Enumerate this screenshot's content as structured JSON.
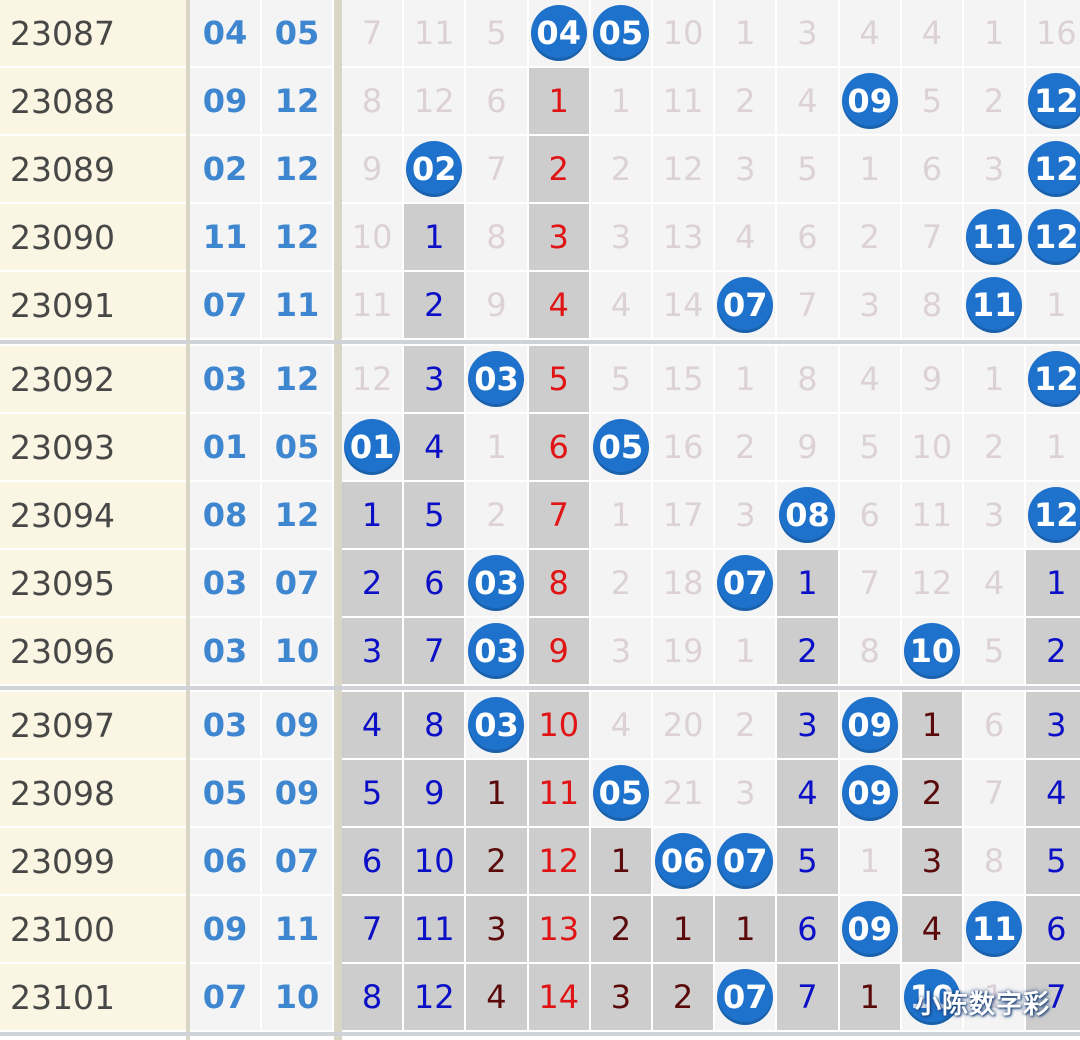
{
  "rows": [
    {
      "issue": "23087",
      "draw": [
        "04",
        "05"
      ],
      "cells": [
        {
          "t": "7",
          "s": "cold"
        },
        {
          "t": "11",
          "s": "cold"
        },
        {
          "t": "5",
          "s": "cold"
        },
        {
          "t": "04",
          "s": "ball"
        },
        {
          "t": "05",
          "s": "ball"
        },
        {
          "t": "10",
          "s": "cold"
        },
        {
          "t": "1",
          "s": "cold"
        },
        {
          "t": "3",
          "s": "cold"
        },
        {
          "t": "4",
          "s": "cold"
        },
        {
          "t": "4",
          "s": "cold"
        },
        {
          "t": "1",
          "s": "cold"
        },
        {
          "t": "16",
          "s": "cold"
        }
      ]
    },
    {
      "issue": "23088",
      "draw": [
        "09",
        "12"
      ],
      "cells": [
        {
          "t": "8",
          "s": "cold"
        },
        {
          "t": "12",
          "s": "cold"
        },
        {
          "t": "6",
          "s": "cold"
        },
        {
          "t": "1",
          "s": "red"
        },
        {
          "t": "1",
          "s": "cold"
        },
        {
          "t": "11",
          "s": "cold"
        },
        {
          "t": "2",
          "s": "cold"
        },
        {
          "t": "4",
          "s": "cold"
        },
        {
          "t": "09",
          "s": "ball"
        },
        {
          "t": "5",
          "s": "cold"
        },
        {
          "t": "2",
          "s": "cold"
        },
        {
          "t": "12",
          "s": "ball"
        }
      ]
    },
    {
      "issue": "23089",
      "draw": [
        "02",
        "12"
      ],
      "cells": [
        {
          "t": "9",
          "s": "cold"
        },
        {
          "t": "02",
          "s": "ball"
        },
        {
          "t": "7",
          "s": "cold"
        },
        {
          "t": "2",
          "s": "red"
        },
        {
          "t": "2",
          "s": "cold"
        },
        {
          "t": "12",
          "s": "cold"
        },
        {
          "t": "3",
          "s": "cold"
        },
        {
          "t": "5",
          "s": "cold"
        },
        {
          "t": "1",
          "s": "cold"
        },
        {
          "t": "6",
          "s": "cold"
        },
        {
          "t": "3",
          "s": "cold"
        },
        {
          "t": "12",
          "s": "ball"
        }
      ]
    },
    {
      "issue": "23090",
      "draw": [
        "11",
        "12"
      ],
      "cells": [
        {
          "t": "10",
          "s": "cold"
        },
        {
          "t": "1",
          "s": "blue"
        },
        {
          "t": "8",
          "s": "cold"
        },
        {
          "t": "3",
          "s": "red"
        },
        {
          "t": "3",
          "s": "cold"
        },
        {
          "t": "13",
          "s": "cold"
        },
        {
          "t": "4",
          "s": "cold"
        },
        {
          "t": "6",
          "s": "cold"
        },
        {
          "t": "2",
          "s": "cold"
        },
        {
          "t": "7",
          "s": "cold"
        },
        {
          "t": "11",
          "s": "ball"
        },
        {
          "t": "12",
          "s": "ball"
        }
      ]
    },
    {
      "issue": "23091",
      "draw": [
        "07",
        "11"
      ],
      "cells": [
        {
          "t": "11",
          "s": "cold"
        },
        {
          "t": "2",
          "s": "blue"
        },
        {
          "t": "9",
          "s": "cold"
        },
        {
          "t": "4",
          "s": "red"
        },
        {
          "t": "4",
          "s": "cold"
        },
        {
          "t": "14",
          "s": "cold"
        },
        {
          "t": "07",
          "s": "ball"
        },
        {
          "t": "7",
          "s": "cold"
        },
        {
          "t": "3",
          "s": "cold"
        },
        {
          "t": "8",
          "s": "cold"
        },
        {
          "t": "11",
          "s": "ball"
        },
        {
          "t": "1",
          "s": "cold"
        }
      ]
    },
    {
      "issue": "23092",
      "draw": [
        "03",
        "12"
      ],
      "cells": [
        {
          "t": "12",
          "s": "cold"
        },
        {
          "t": "3",
          "s": "blue"
        },
        {
          "t": "03",
          "s": "ball"
        },
        {
          "t": "5",
          "s": "red"
        },
        {
          "t": "5",
          "s": "cold"
        },
        {
          "t": "15",
          "s": "cold"
        },
        {
          "t": "1",
          "s": "cold"
        },
        {
          "t": "8",
          "s": "cold"
        },
        {
          "t": "4",
          "s": "cold"
        },
        {
          "t": "9",
          "s": "cold"
        },
        {
          "t": "1",
          "s": "cold"
        },
        {
          "t": "12",
          "s": "ball"
        }
      ]
    },
    {
      "issue": "23093",
      "draw": [
        "01",
        "05"
      ],
      "cells": [
        {
          "t": "01",
          "s": "ball"
        },
        {
          "t": "4",
          "s": "blue"
        },
        {
          "t": "1",
          "s": "cold"
        },
        {
          "t": "6",
          "s": "red"
        },
        {
          "t": "05",
          "s": "ball"
        },
        {
          "t": "16",
          "s": "cold"
        },
        {
          "t": "2",
          "s": "cold"
        },
        {
          "t": "9",
          "s": "cold"
        },
        {
          "t": "5",
          "s": "cold"
        },
        {
          "t": "10",
          "s": "cold"
        },
        {
          "t": "2",
          "s": "cold"
        },
        {
          "t": "1",
          "s": "cold"
        }
      ]
    },
    {
      "issue": "23094",
      "draw": [
        "08",
        "12"
      ],
      "cells": [
        {
          "t": "1",
          "s": "blue"
        },
        {
          "t": "5",
          "s": "blue"
        },
        {
          "t": "2",
          "s": "cold"
        },
        {
          "t": "7",
          "s": "red"
        },
        {
          "t": "1",
          "s": "cold"
        },
        {
          "t": "17",
          "s": "cold"
        },
        {
          "t": "3",
          "s": "cold"
        },
        {
          "t": "08",
          "s": "ball"
        },
        {
          "t": "6",
          "s": "cold"
        },
        {
          "t": "11",
          "s": "cold"
        },
        {
          "t": "3",
          "s": "cold"
        },
        {
          "t": "12",
          "s": "ball"
        }
      ]
    },
    {
      "issue": "23095",
      "draw": [
        "03",
        "07"
      ],
      "cells": [
        {
          "t": "2",
          "s": "blue"
        },
        {
          "t": "6",
          "s": "blue"
        },
        {
          "t": "03",
          "s": "ball"
        },
        {
          "t": "8",
          "s": "red"
        },
        {
          "t": "2",
          "s": "cold"
        },
        {
          "t": "18",
          "s": "cold"
        },
        {
          "t": "07",
          "s": "ball"
        },
        {
          "t": "1",
          "s": "blue"
        },
        {
          "t": "7",
          "s": "cold"
        },
        {
          "t": "12",
          "s": "cold"
        },
        {
          "t": "4",
          "s": "cold"
        },
        {
          "t": "1",
          "s": "blue"
        }
      ]
    },
    {
      "issue": "23096",
      "draw": [
        "03",
        "10"
      ],
      "cells": [
        {
          "t": "3",
          "s": "blue"
        },
        {
          "t": "7",
          "s": "blue"
        },
        {
          "t": "03",
          "s": "ball"
        },
        {
          "t": "9",
          "s": "red"
        },
        {
          "t": "3",
          "s": "cold"
        },
        {
          "t": "19",
          "s": "cold"
        },
        {
          "t": "1",
          "s": "cold"
        },
        {
          "t": "2",
          "s": "blue"
        },
        {
          "t": "8",
          "s": "cold"
        },
        {
          "t": "10",
          "s": "ball"
        },
        {
          "t": "5",
          "s": "cold"
        },
        {
          "t": "2",
          "s": "blue"
        }
      ]
    },
    {
      "issue": "23097",
      "draw": [
        "03",
        "09"
      ],
      "cells": [
        {
          "t": "4",
          "s": "blue"
        },
        {
          "t": "8",
          "s": "blue"
        },
        {
          "t": "03",
          "s": "ball"
        },
        {
          "t": "10",
          "s": "red"
        },
        {
          "t": "4",
          "s": "cold"
        },
        {
          "t": "20",
          "s": "cold"
        },
        {
          "t": "2",
          "s": "cold"
        },
        {
          "t": "3",
          "s": "blue"
        },
        {
          "t": "09",
          "s": "ball"
        },
        {
          "t": "1",
          "s": "dark"
        },
        {
          "t": "6",
          "s": "cold"
        },
        {
          "t": "3",
          "s": "blue"
        }
      ]
    },
    {
      "issue": "23098",
      "draw": [
        "05",
        "09"
      ],
      "cells": [
        {
          "t": "5",
          "s": "blue"
        },
        {
          "t": "9",
          "s": "blue"
        },
        {
          "t": "1",
          "s": "dark"
        },
        {
          "t": "11",
          "s": "red"
        },
        {
          "t": "05",
          "s": "ball"
        },
        {
          "t": "21",
          "s": "cold"
        },
        {
          "t": "3",
          "s": "cold"
        },
        {
          "t": "4",
          "s": "blue"
        },
        {
          "t": "09",
          "s": "ball"
        },
        {
          "t": "2",
          "s": "dark"
        },
        {
          "t": "7",
          "s": "cold"
        },
        {
          "t": "4",
          "s": "blue"
        }
      ]
    },
    {
      "issue": "23099",
      "draw": [
        "06",
        "07"
      ],
      "cells": [
        {
          "t": "6",
          "s": "blue"
        },
        {
          "t": "10",
          "s": "blue"
        },
        {
          "t": "2",
          "s": "dark"
        },
        {
          "t": "12",
          "s": "red"
        },
        {
          "t": "1",
          "s": "dark"
        },
        {
          "t": "06",
          "s": "ball"
        },
        {
          "t": "07",
          "s": "ball"
        },
        {
          "t": "5",
          "s": "blue"
        },
        {
          "t": "1",
          "s": "cold"
        },
        {
          "t": "3",
          "s": "dark"
        },
        {
          "t": "8",
          "s": "cold"
        },
        {
          "t": "5",
          "s": "blue"
        }
      ]
    },
    {
      "issue": "23100",
      "draw": [
        "09",
        "11"
      ],
      "cells": [
        {
          "t": "7",
          "s": "blue"
        },
        {
          "t": "11",
          "s": "blue"
        },
        {
          "t": "3",
          "s": "dark"
        },
        {
          "t": "13",
          "s": "red"
        },
        {
          "t": "2",
          "s": "dark"
        },
        {
          "t": "1",
          "s": "dark"
        },
        {
          "t": "1",
          "s": "dark"
        },
        {
          "t": "6",
          "s": "blue"
        },
        {
          "t": "09",
          "s": "ball"
        },
        {
          "t": "4",
          "s": "dark"
        },
        {
          "t": "11",
          "s": "ball"
        },
        {
          "t": "6",
          "s": "blue"
        }
      ]
    },
    {
      "issue": "23101",
      "draw": [
        "07",
        "10"
      ],
      "cells": [
        {
          "t": "8",
          "s": "blue"
        },
        {
          "t": "12",
          "s": "blue"
        },
        {
          "t": "4",
          "s": "dark"
        },
        {
          "t": "14",
          "s": "red"
        },
        {
          "t": "3",
          "s": "dark"
        },
        {
          "t": "2",
          "s": "dark"
        },
        {
          "t": "07",
          "s": "ball"
        },
        {
          "t": "7",
          "s": "blue"
        },
        {
          "t": "1",
          "s": "dark"
        },
        {
          "t": "10",
          "s": "ball"
        },
        {
          "t": "1",
          "s": "cold"
        },
        {
          "t": "7",
          "s": "blue"
        }
      ]
    }
  ],
  "watermark": "小陈数字彩",
  "colors": {
    "ball": "#1f72cb",
    "issue_bg": "#fbf6e4",
    "draw_text": "#3f86d0",
    "hot_blue": "#0b10c6",
    "hot_red": "#e01414",
    "hot_dark": "#5a0a0a",
    "cold_text": "#ddd1d8"
  }
}
